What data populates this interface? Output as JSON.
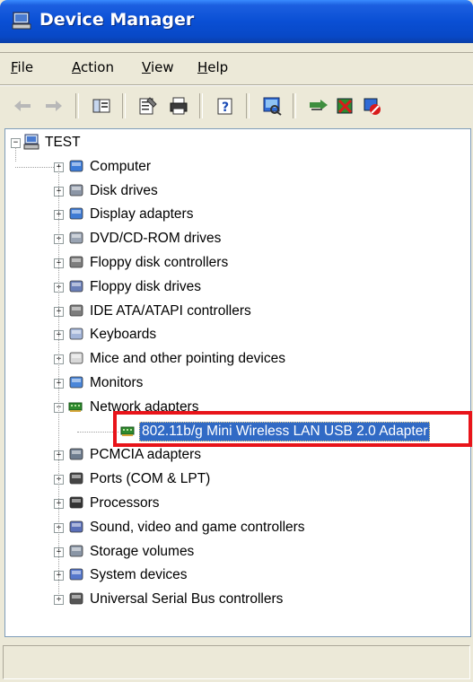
{
  "window": {
    "title": "Device Manager"
  },
  "menu": [
    {
      "label": "File",
      "accel": "F",
      "rest": "ile"
    },
    {
      "label": "Action",
      "accel": "A",
      "rest": "ction"
    },
    {
      "label": "View",
      "accel": "V",
      "rest": "iew"
    },
    {
      "label": "Help",
      "accel": "H",
      "rest": "elp"
    }
  ],
  "toolbar": {
    "icons": [
      "back-arrow-icon",
      "forward-arrow-icon",
      "show-hide-console-tree-icon",
      "properties-icon",
      "print-icon",
      "help-icon",
      "scan-hardware-icon",
      "update-driver-icon",
      "uninstall-icon",
      "disable-icon"
    ]
  },
  "tree": {
    "root": "TEST",
    "categories": [
      {
        "label": "Computer"
      },
      {
        "label": "Disk drives"
      },
      {
        "label": "Display adapters"
      },
      {
        "label": "DVD/CD-ROM drives"
      },
      {
        "label": "Floppy disk controllers"
      },
      {
        "label": "Floppy disk drives"
      },
      {
        "label": "IDE ATA/ATAPI controllers"
      },
      {
        "label": "Keyboards"
      },
      {
        "label": "Mice and other pointing devices"
      },
      {
        "label": "Monitors"
      },
      {
        "label": "Network adapters",
        "expanded": true
      },
      {
        "label": "PCMCIA adapters"
      },
      {
        "label": "Ports (COM & LPT)"
      },
      {
        "label": "Processors"
      },
      {
        "label": "Sound, video and game controllers"
      },
      {
        "label": "Storage volumes"
      },
      {
        "label": "System devices"
      },
      {
        "label": "Universal Serial Bus controllers"
      }
    ],
    "selected_child": "802.11b/g Mini Wireless LAN USB 2.0 Adapter"
  },
  "colors": {
    "title_bar": "#0A4FD4",
    "selection": "#316AC5",
    "highlight_box": "#E8141A"
  }
}
